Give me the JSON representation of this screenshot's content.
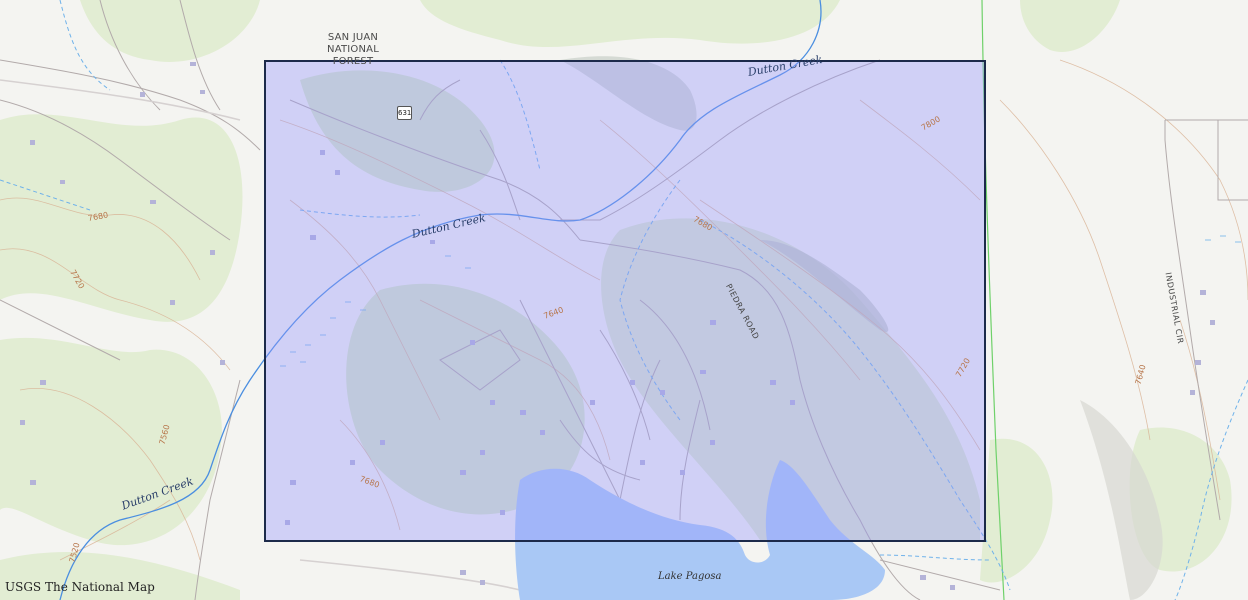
{
  "map": {
    "attribution": "USGS The National Map",
    "forest_label_line1": "SAN JUAN",
    "forest_label_line2": "NATIONAL",
    "forest_label_line3": "FOREST",
    "route_shield": "631",
    "creek_labels": [
      "Dutton Creek",
      "Dutton Creek",
      "Dutton Creek"
    ],
    "road_labels": [
      "PIEDRA ROAD",
      "INDUSTRIAL CIR"
    ],
    "lake_label": "Lake Pagosa",
    "contour_labels": [
      "7800",
      "7680",
      "7680",
      "7720",
      "7640",
      "7720",
      "7640",
      "7560",
      "7680",
      "7520"
    ],
    "colors": {
      "selection_fill": "#9696ff",
      "selection_border": "#1c2a4a",
      "water": "#a9c8f5",
      "stream": "#4a8ee0",
      "vegetation": "#dfeccf",
      "contour": "#d6a583",
      "road": "#a8a0a0",
      "boundary": "#6fd16a"
    }
  }
}
